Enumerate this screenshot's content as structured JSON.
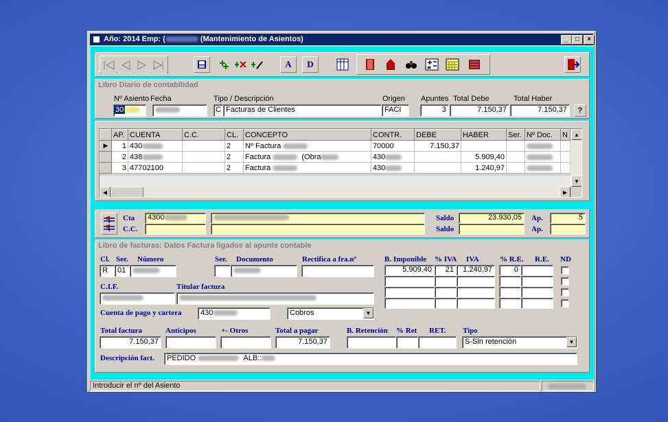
{
  "window": {
    "title": "Año: 2014 Emp: (",
    "title_suffix": " (Mantenimiento de Asientos)",
    "min": "_",
    "max": "□",
    "close": "×"
  },
  "toolbar": {
    "nav_icons": [
      "first-icon",
      "prev-icon",
      "next-icon",
      "last-icon"
    ],
    "letter_a": "A",
    "letter_d": "D"
  },
  "diario": {
    "section_title": "Libro Diario de contabilidad",
    "labels": {
      "asiento": "Nº Asiento",
      "fecha": "Fecha",
      "tipo": "Tipo / Descripción",
      "origen": "Origen",
      "apuntes": "Apuntes",
      "total_debe": "Total Debe",
      "total_haber": "Total Haber"
    },
    "values": {
      "asiento": "30",
      "tipo_code": "C",
      "tipo_desc": "Facturas de Clientes",
      "origen": "FACI",
      "apuntes": "3",
      "total_debe": "7.150,37",
      "total_haber": "7.150,37"
    },
    "help": "?"
  },
  "grid": {
    "columns": [
      "AP.",
      "CUENTA",
      "C.C.",
      "CL.",
      "CONCEPTO",
      "CONTR.",
      "DEBE",
      "HABER",
      "Ser.",
      "Nº Doc.",
      "N"
    ],
    "rows": [
      {
        "ap": "1",
        "cuenta": "430",
        "cc": "",
        "cl": "2",
        "concepto": "Nº Factura",
        "obra": "",
        "contr": "70000",
        "debe": "7.150,37",
        "haber": ""
      },
      {
        "ap": "2",
        "cuenta": "438",
        "cc": "",
        "cl": "2",
        "concepto": "Factura",
        "obra": "(Obra",
        "contr": "430",
        "debe": "",
        "haber": "5.909,40"
      },
      {
        "ap": "3",
        "cuenta": "47702100",
        "cc": "",
        "cl": "2",
        "concepto": "Factura",
        "obra": "",
        "contr": "430",
        "debe": "",
        "haber": "1.240,97"
      }
    ],
    "indicator": "▶"
  },
  "cuenta_panel": {
    "cta_label": "Cta",
    "cc_label": "C.C.",
    "cta_value": "4300",
    "saldo_label": "Saldo",
    "saldo_value": "23.930,05",
    "ap_label": "Ap.",
    "ap_value": "5"
  },
  "facturas": {
    "section_title": "Libro de facturas: Datos Factura ligados al apunte contable",
    "labels": {
      "cl": "Cl.",
      "ser": "Ser.",
      "numero": "Número",
      "ser2": "Ser.",
      "documento": "Documento",
      "rectifica": "Rectifica a fra.nº",
      "base": "B. Imponible",
      "piva": "% IVA",
      "iva": "IVA",
      "pre": "% R.E.",
      "re": "R.E.",
      "nd": "ND",
      "cif": "C.I.F.",
      "titular": "Títular factura",
      "cuenta_pago": "Cuenta de pago y cartera",
      "total_factura": "Total factura",
      "anticipos": "Anticipos",
      "otros": "+- Otros",
      "total_pagar": "Total a pagar",
      "b_retencion": "B. Retención",
      "pret": "% Ret",
      "ret": "RET.",
      "tipo": "Tipo",
      "descripcion": "Descripción fact."
    },
    "values": {
      "cl": "R",
      "ser": "01",
      "base": "5.909,40",
      "piva": "21",
      "iva": "1.240,97",
      "pre": "0",
      "cuenta_pago": "430",
      "cobros": "Cobros",
      "total_factura": "7.150,37",
      "total_pagar": "7.150,37",
      "tipo": "S-Sin retención",
      "descripcion_a": "PEDIDO",
      "descripcion_b": "ALB::"
    }
  },
  "status": {
    "text": "Introducir el nº del Asiento"
  }
}
